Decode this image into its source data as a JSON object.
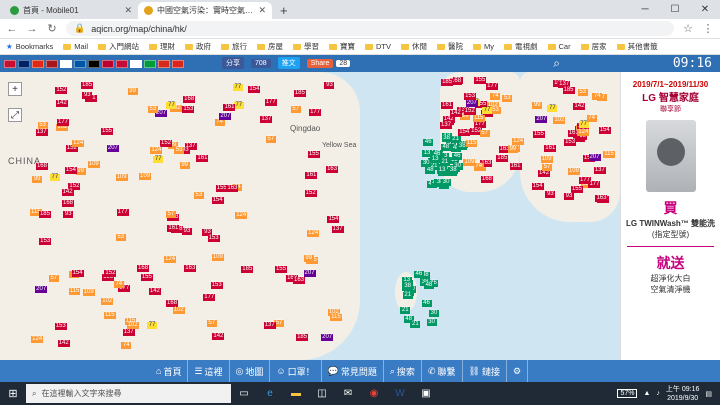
{
  "browser": {
    "tabs": [
      {
        "title": "首頁 - Mobile01",
        "active": false,
        "color": "#2b9c3e"
      },
      {
        "title": "中國空氣污染：實時空氣質量指數地圖",
        "active": true,
        "color": "#e3a21a"
      }
    ],
    "new_tab": "+",
    "url": "aqicn.org/map/china/hk/",
    "bookmarks": [
      "Bookmarks",
      "Mail",
      "入門網站",
      "理財",
      "政府",
      "旅行",
      "房屋",
      "學習",
      "寶寶",
      "DTV",
      "休閒",
      "醫院",
      "My",
      "電視劇",
      "Car",
      "居家",
      "其他書籤"
    ]
  },
  "site": {
    "share_label": "分享",
    "like_label": "708",
    "tweet_label": "推文",
    "share2_label": "Share",
    "share_count": "28",
    "clock": "09:16",
    "flags": [
      "#c8102e",
      "#012169",
      "#de2910",
      "#aa151b",
      "#ffffff",
      "#0055a4",
      "#000000",
      "#bc002d",
      "#c60c30",
      "#ffffff",
      "#009c3b",
      "#d52b1e",
      "#da251d"
    ]
  },
  "map": {
    "labels": {
      "china": "CHINA",
      "qingdao": "Qingdao",
      "yellow_sea": "Yellow Sea"
    },
    "legend_colors": {
      "good": "#009966",
      "moderate": "#ffde33",
      "sensitive": "#ff9933",
      "unhealthy": "#cc0033",
      "very_unhealthy": "#660099"
    },
    "markers": [
      {
        "v": "93",
        "c": "unhealthy"
      },
      {
        "v": "152",
        "c": "unhealthy"
      },
      {
        "v": "163",
        "c": "unhealthy"
      },
      {
        "v": "57",
        "c": "sensitive"
      },
      {
        "v": "168",
        "c": "unhealthy"
      },
      {
        "v": "177",
        "c": "unhealthy"
      },
      {
        "v": "77",
        "c": "moderate"
      },
      {
        "v": "137",
        "c": "unhealthy"
      },
      {
        "v": "74",
        "c": "sensitive"
      },
      {
        "v": "185",
        "c": "unhealthy"
      },
      {
        "v": "161",
        "c": "unhealthy"
      },
      {
        "v": "207",
        "c": "very_unhealthy"
      },
      {
        "v": "13",
        "c": "good"
      },
      {
        "v": "21",
        "c": "good"
      },
      {
        "v": "30",
        "c": "good"
      },
      {
        "v": "38",
        "c": "good"
      },
      {
        "v": "46",
        "c": "good"
      },
      {
        "v": "99",
        "c": "sensitive"
      },
      {
        "v": "154",
        "c": "unhealthy"
      },
      {
        "v": "142",
        "c": "unhealthy"
      },
      {
        "v": "109",
        "c": "sensitive"
      },
      {
        "v": "153",
        "c": "unhealthy"
      },
      {
        "v": "115",
        "c": "sensitive"
      },
      {
        "v": "155",
        "c": "unhealthy"
      },
      {
        "v": "53",
        "c": "sensitive"
      },
      {
        "v": "48",
        "c": "good"
      },
      {
        "v": "124",
        "c": "sensitive"
      },
      {
        "v": "102",
        "c": "sensitive"
      }
    ]
  },
  "ad": {
    "date": "2019/7/1~2019/11/30",
    "brand": "LG 智慧家庭",
    "brand_sub": "聯享節",
    "buy": "買",
    "product": "LG TWINWash™ 雙能洗",
    "product_sub": "(指定型號)",
    "gift": "就送",
    "gift_item": "超淨化大白",
    "gift_item2": "空氣清淨機"
  },
  "bottom_nav": [
    "首頁",
    "這裡",
    "地圖",
    "口罩！",
    "常見問題",
    "搜索",
    "聯繫",
    "鏈接"
  ],
  "taskbar": {
    "search_placeholder": "在這裡輸入文字來搜尋",
    "battery": "57%",
    "time": "上午 09:16",
    "date": "2019/9/30"
  }
}
